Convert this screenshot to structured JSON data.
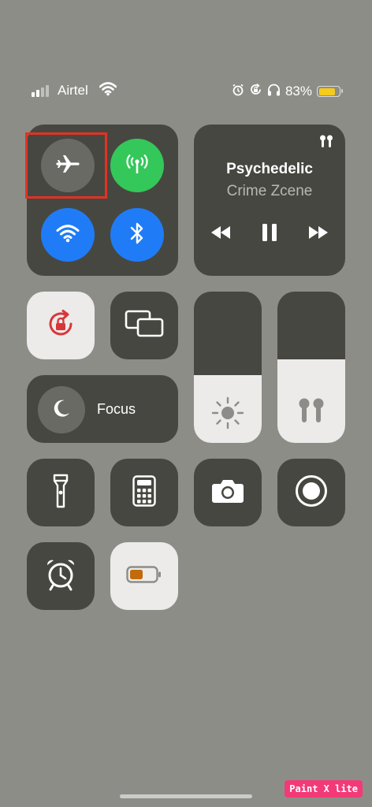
{
  "status_bar": {
    "carrier": "Airtel",
    "battery_percent": "83%",
    "battery_level": 0.83,
    "signal_bars_active": 2,
    "signal_bars_total": 4,
    "icons": [
      "wifi-icon",
      "alarm-icon",
      "rotation-lock-icon",
      "headphones-icon"
    ]
  },
  "connectivity": {
    "airplane_mode": {
      "icon": "airplane-icon",
      "state": "off"
    },
    "cellular_data": {
      "icon": "cellular-antenna-icon",
      "state": "on",
      "color": "#34c759"
    },
    "wifi": {
      "icon": "wifi-icon",
      "state": "on",
      "color": "#1f7cf6"
    },
    "bluetooth": {
      "icon": "bluetooth-icon",
      "state": "on",
      "color": "#1f7cf6"
    }
  },
  "now_playing": {
    "title": "Psychedelic",
    "artist": "Crime Zcene",
    "route_icon": "airpods-icon",
    "controls": [
      "rewind-icon",
      "pause-icon",
      "fast-forward-icon"
    ]
  },
  "orientation_lock": {
    "icon": "rotation-lock-icon",
    "state": "on",
    "accent": "#d7373b"
  },
  "screen_mirroring": {
    "icon": "screen-mirroring-icon"
  },
  "focus": {
    "label": "Focus",
    "icon": "moon-icon"
  },
  "brightness": {
    "icon": "sun-icon",
    "level": 0.45
  },
  "volume": {
    "icon": "airpods-icon",
    "level": 0.55
  },
  "shortcuts": [
    "flashlight-icon",
    "calculator-icon",
    "camera-icon",
    "screen-record-icon",
    "alarm-clock-icon",
    "low-power-mode-icon"
  ],
  "low_power": {
    "state": "on",
    "accent": "#c26a0c"
  },
  "watermark": "Paint X lite"
}
